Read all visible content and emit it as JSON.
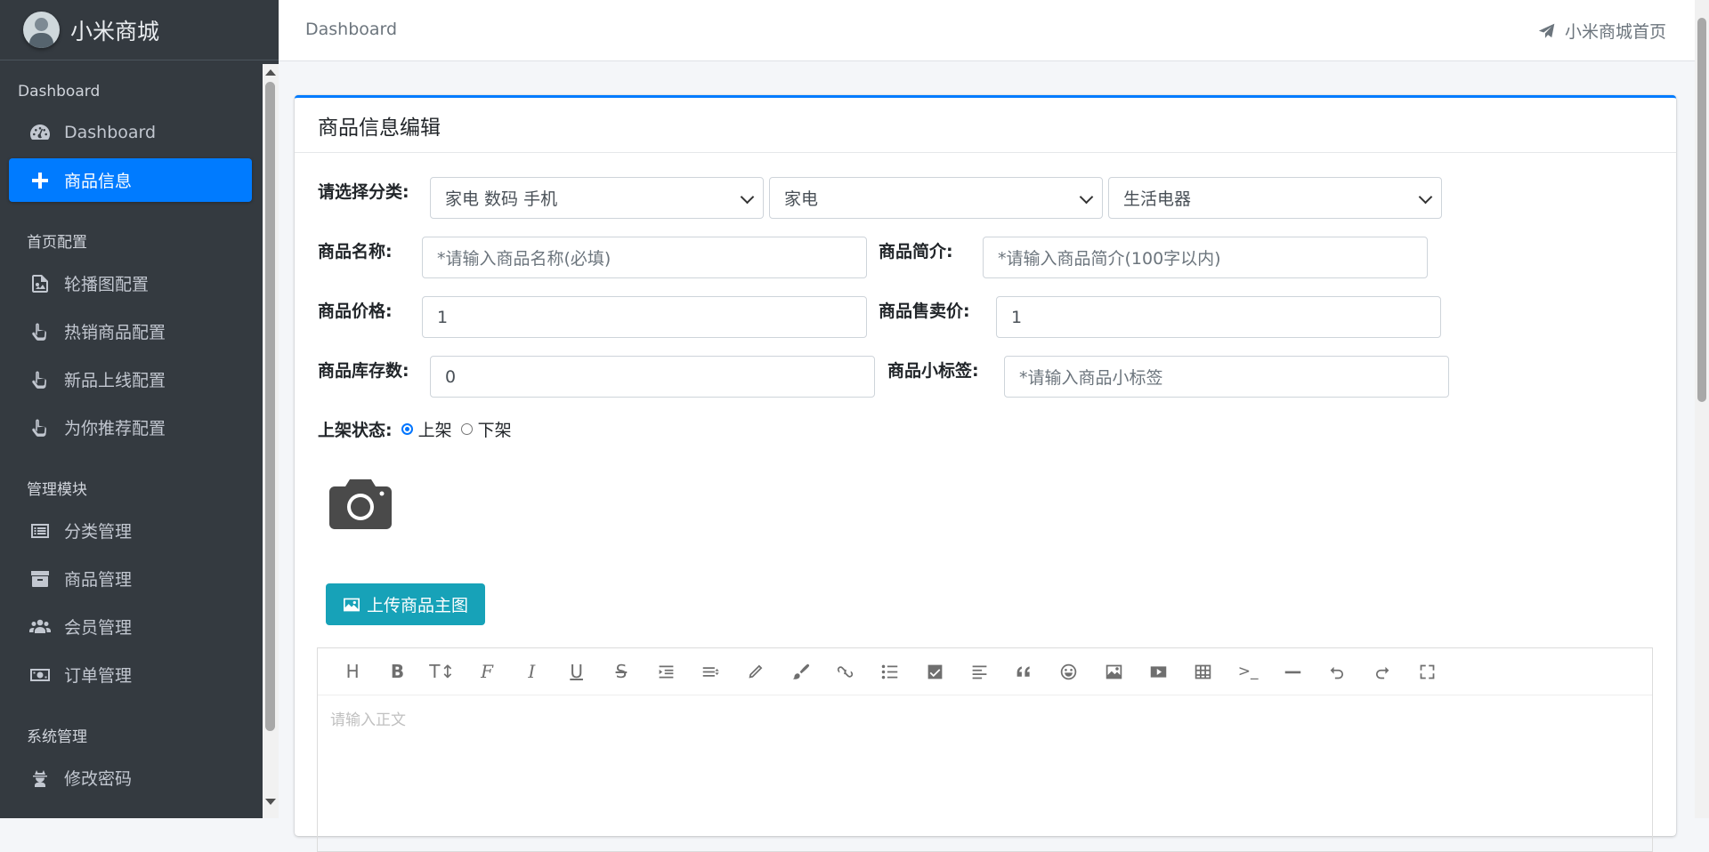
{
  "app": {
    "brand_name": "小米商城"
  },
  "sidebar": {
    "sections": [
      {
        "header": "Dashboard"
      },
      {
        "header": "首页配置"
      },
      {
        "header": "管理模块"
      },
      {
        "header": "系统管理"
      }
    ],
    "items": [
      {
        "label": "Dashboard",
        "icon": "tachometer-icon",
        "active": false
      },
      {
        "label": "商品信息",
        "icon": "plus-icon",
        "active": true
      },
      {
        "label": "轮播图配置",
        "icon": "image-file-icon",
        "active": false
      },
      {
        "label": "热销商品配置",
        "icon": "hand-pointer-icon",
        "active": false
      },
      {
        "label": "新品上线配置",
        "icon": "hand-pointer-icon",
        "active": false
      },
      {
        "label": "为你推荐配置",
        "icon": "hand-pointer-icon",
        "active": false
      },
      {
        "label": "分类管理",
        "icon": "list-alt-icon",
        "active": false
      },
      {
        "label": "商品管理",
        "icon": "archive-icon",
        "active": false
      },
      {
        "label": "会员管理",
        "icon": "users-icon",
        "active": false
      },
      {
        "label": "订单管理",
        "icon": "money-bill-icon",
        "active": false
      },
      {
        "label": "修改密码",
        "icon": "user-secret-icon",
        "active": false
      }
    ]
  },
  "topbar": {
    "breadcrumb": "Dashboard",
    "home_link": "小米商城首页"
  },
  "card": {
    "title": "商品信息编辑"
  },
  "form": {
    "category_label": "请选择分类:",
    "category_level1": "家电 数码 手机",
    "category_level2": "家电",
    "category_level3": "生活电器",
    "name_label": "商品名称:",
    "name_placeholder": "*请输入商品名称(必填)",
    "intro_label": "商品简介:",
    "intro_placeholder": "*请输入商品简介(100字以内)",
    "price_label": "商品价格:",
    "price_value": "1",
    "sell_price_label": "商品售卖价:",
    "sell_price_value": "1",
    "stock_label": "商品库存数:",
    "stock_value": "0",
    "tag_label": "商品小标签:",
    "tag_placeholder": "*请输入商品小标签",
    "status_label": "上架状态:",
    "status_on": "上架",
    "status_off": "下架",
    "status_selected": "上架",
    "upload_button": "上传商品主图"
  },
  "editor": {
    "placeholder": "请输入正文",
    "toolbar": [
      "heading",
      "bold",
      "font-size",
      "font-family",
      "italic",
      "underline",
      "strikethrough",
      "indent",
      "line-height",
      "pen",
      "paint-brush",
      "link",
      "list",
      "check-square",
      "align",
      "quote",
      "emoji",
      "image",
      "video",
      "table",
      "code",
      "hr",
      "undo",
      "redo",
      "fullscreen"
    ]
  }
}
